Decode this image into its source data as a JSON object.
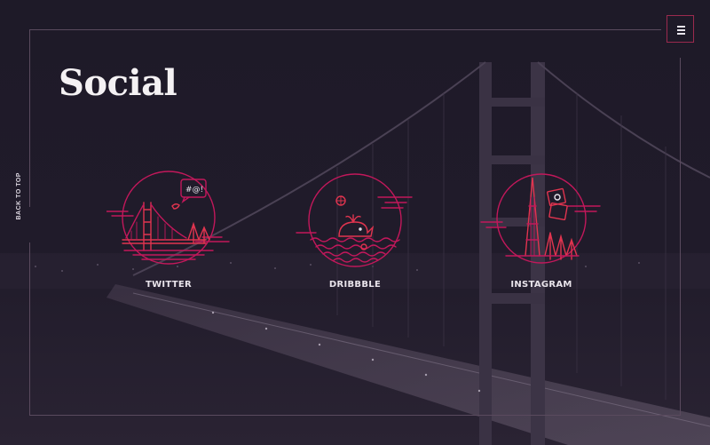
{
  "header": {
    "title": "Social"
  },
  "menu": {
    "icon": "hamburger-menu-icon"
  },
  "back_to_top": {
    "label": "BACK TO TOP"
  },
  "social_links": [
    {
      "label": "TWITTER",
      "icon": "golden-gate-bridge-twitter-icon"
    },
    {
      "label": "DRIBBBLE",
      "icon": "whale-dribbble-icon"
    },
    {
      "label": "INSTAGRAM",
      "icon": "transamerica-instagram-icon"
    }
  ],
  "colors": {
    "background": "#1c1826",
    "accent_magenta": "#c2185b",
    "accent_red": "#e0344f",
    "frame": "#5a4a5e",
    "title_text": "#f4f1f3"
  }
}
